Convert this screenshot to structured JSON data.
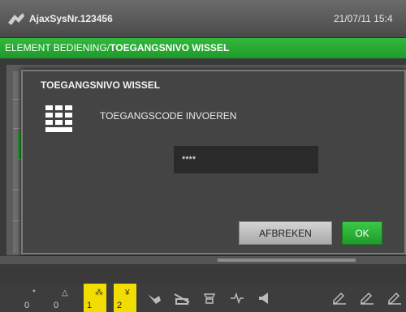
{
  "window": {
    "title": "AjaxSysNr.123456",
    "datetime": "21/07/11 15:4"
  },
  "breadcrumb": {
    "prefix": "ELEMENT BEDIENING/",
    "current": "TOEGANGSNIVO WISSEL"
  },
  "dialog": {
    "title": "TOEGANGSNIVO WISSEL",
    "icon": "keypad-icon",
    "prompt": "TOEGANGSCODE INVOEREN",
    "code_value": "****",
    "cancel_label": "AFBREKEN",
    "ok_label": "OK"
  },
  "status_bar": {
    "counters": [
      {
        "value": "0",
        "symbol": "*",
        "highlight": false
      },
      {
        "value": "0",
        "symbol": "△",
        "highlight": false
      },
      {
        "value": "1",
        "symbol": "⁂",
        "highlight": true
      },
      {
        "value": "2",
        "symbol": "¥",
        "highlight": true
      }
    ],
    "icons": [
      "arrow-icon",
      "barrier-icon",
      "phone-icon",
      "signal-icon",
      "speaker-icon",
      "edit-icon",
      "edit-lock-icon",
      "edit-key-icon"
    ]
  },
  "colors": {
    "accent_green": "#2ea838",
    "highlight_yellow": "#f2dd00"
  }
}
